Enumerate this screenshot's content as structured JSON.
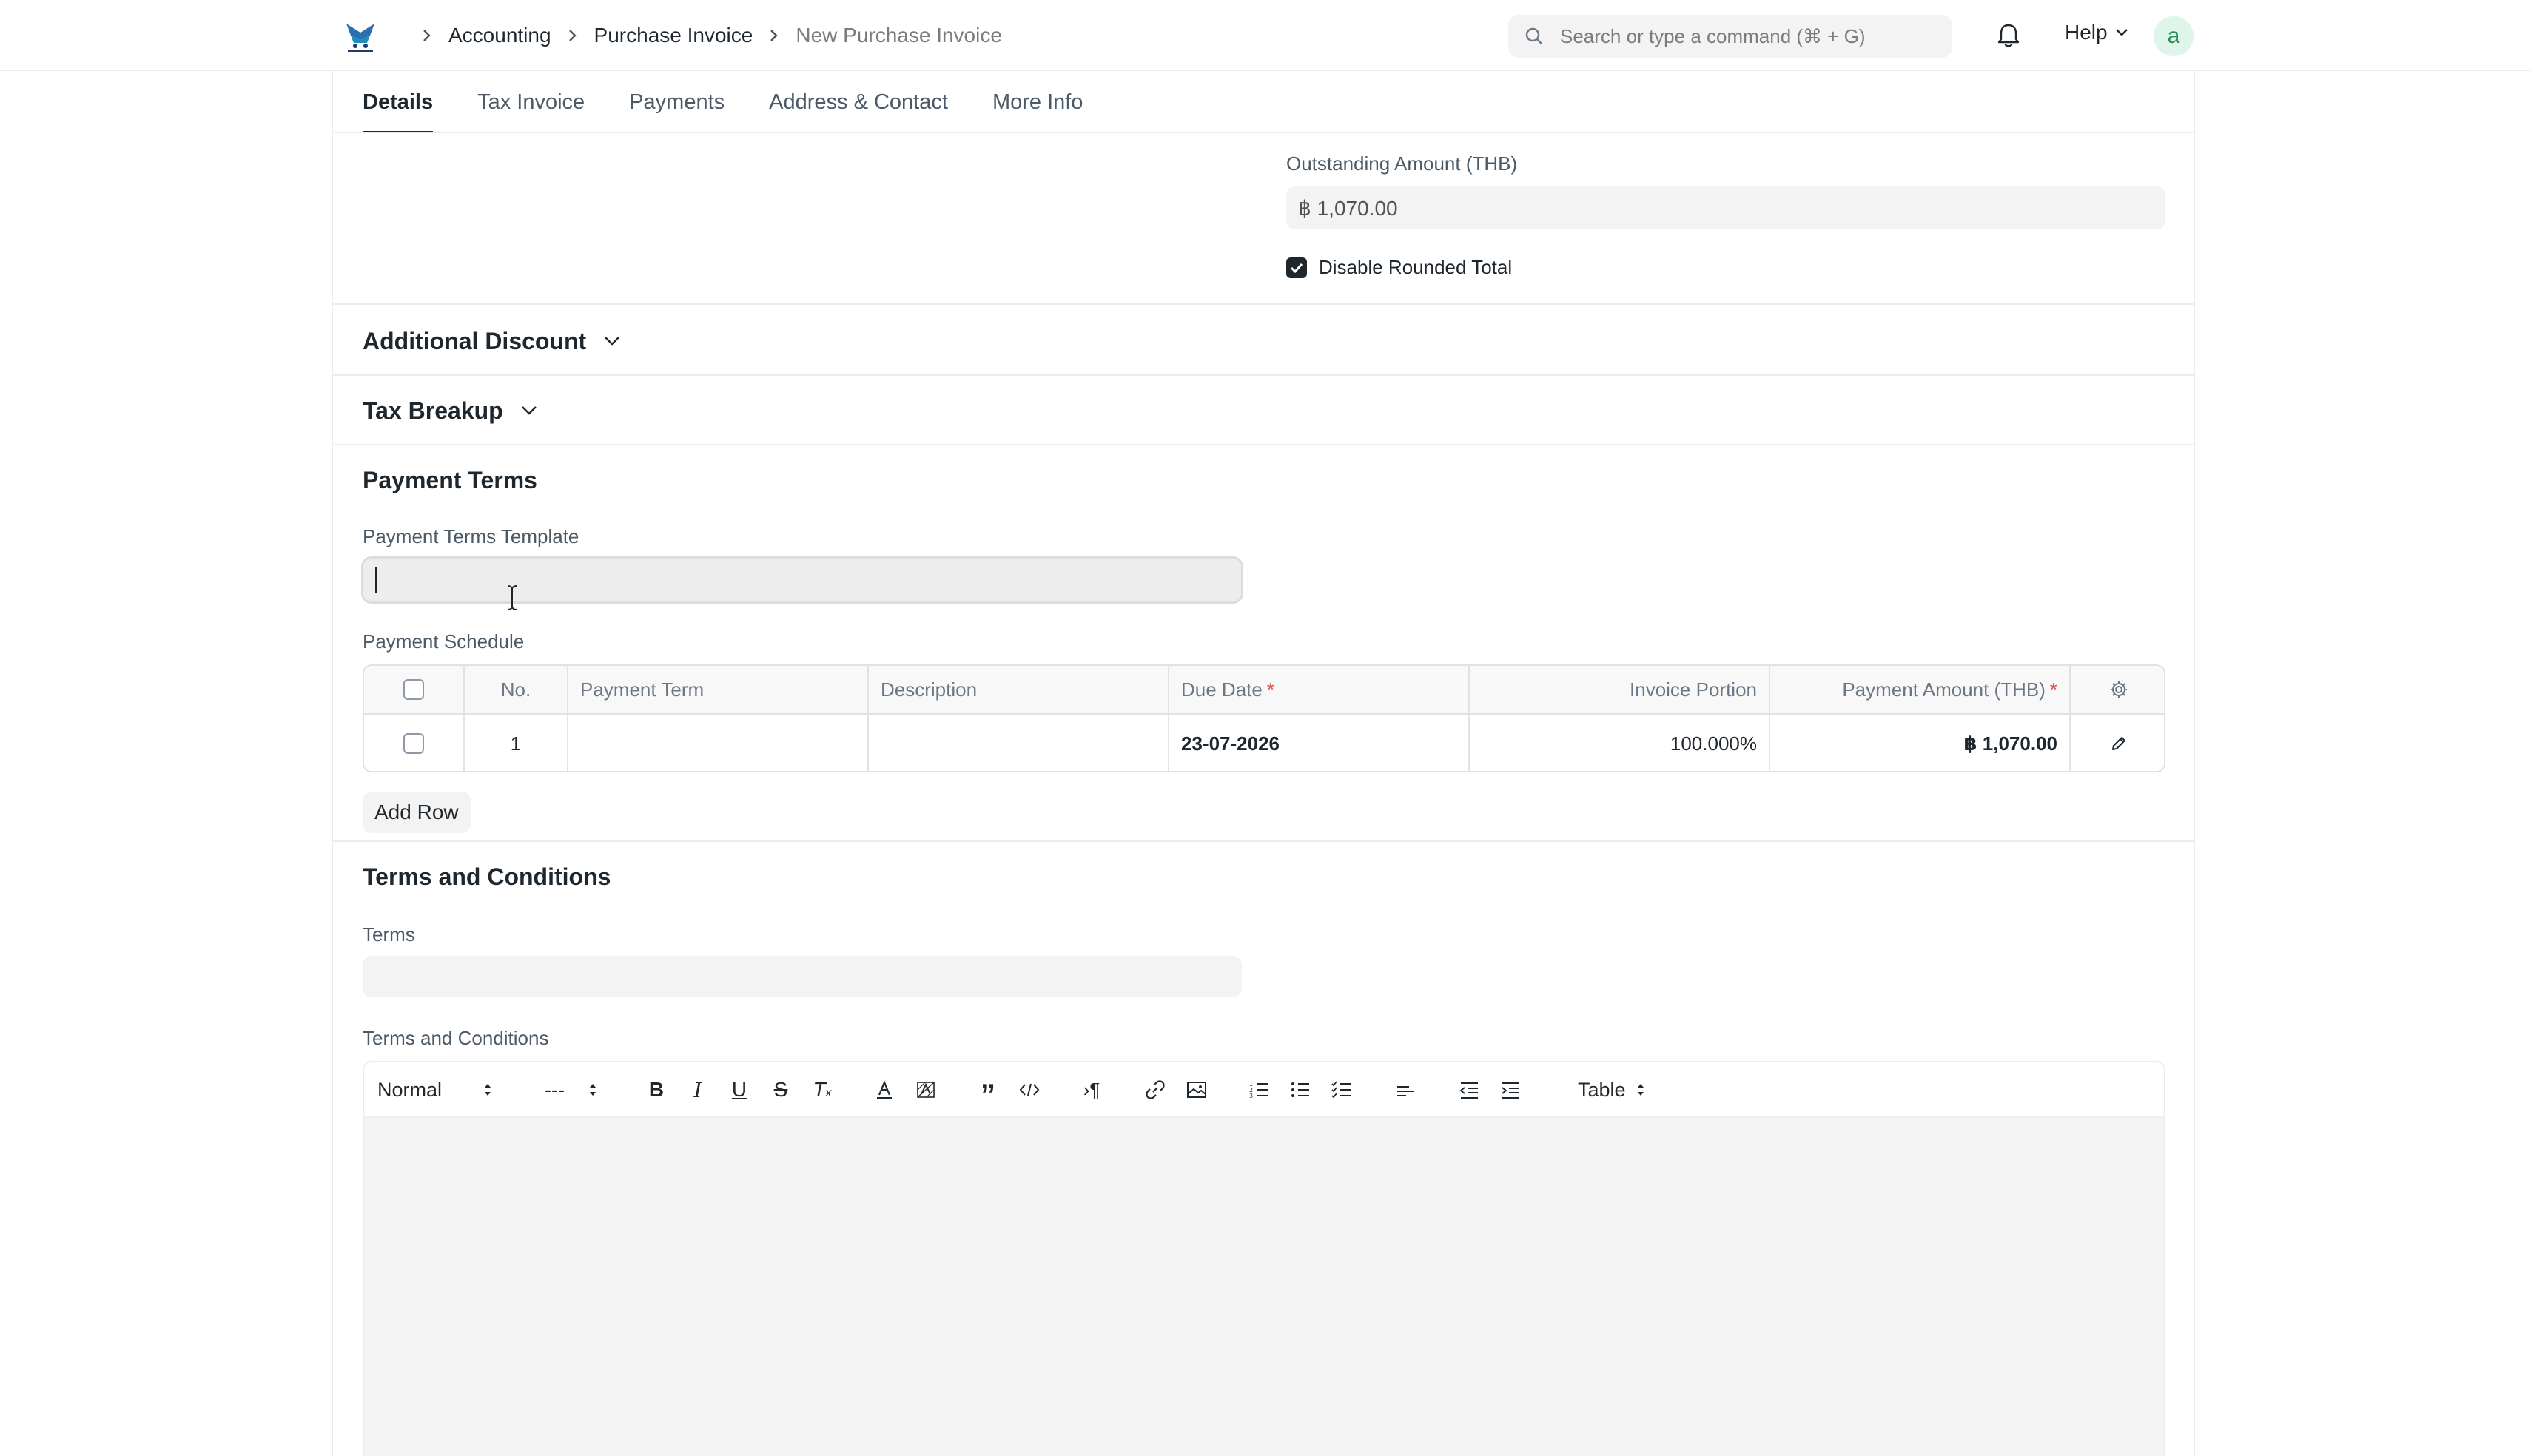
{
  "navbar": {
    "breadcrumbs": [
      "Accounting",
      "Purchase Invoice",
      "New Purchase Invoice"
    ],
    "search_placeholder": "Search or type a command (⌘ + G)",
    "help_label": "Help",
    "avatar_letter": "a"
  },
  "tabs": [
    {
      "label": "Details",
      "active": true
    },
    {
      "label": "Tax Invoice"
    },
    {
      "label": "Payments"
    },
    {
      "label": "Address & Contact"
    },
    {
      "label": "More Info"
    }
  ],
  "outstanding": {
    "label": "Outstanding Amount (THB)",
    "value": "฿ 1,070.00"
  },
  "disable_rounded_total": {
    "label": "Disable Rounded Total",
    "checked": true
  },
  "sections": {
    "additional_discount": "Additional Discount",
    "tax_breakup": "Tax Breakup",
    "payment_terms": "Payment Terms",
    "terms_and_conditions": "Terms and Conditions"
  },
  "payment_terms_template": {
    "label": "Payment Terms Template",
    "value": ""
  },
  "payment_schedule": {
    "label": "Payment Schedule",
    "columns": [
      "No.",
      "Payment Term",
      "Description",
      "Due Date",
      "Invoice Portion",
      "Payment Amount (THB)"
    ],
    "rows": [
      {
        "no": "1",
        "payment_term": "",
        "description": "",
        "due_date": "23-07-2026",
        "invoice_portion": "100.000%",
        "payment_amount": "฿ 1,070.00"
      }
    ],
    "add_row_label": "Add Row"
  },
  "terms": {
    "label": "Terms",
    "value": ""
  },
  "terms_editor": {
    "label": "Terms and Conditions",
    "toolbar": {
      "format": "Normal",
      "size": "---",
      "table": "Table"
    }
  },
  "colors": {
    "text": "#1f272e",
    "muted": "#7c7c7c",
    "field_bg": "#f3f3f3",
    "border": "#ececec",
    "required": "#e24c4c",
    "avatar_bg": "#dff5ea",
    "avatar_fg": "#2a8d5c"
  }
}
